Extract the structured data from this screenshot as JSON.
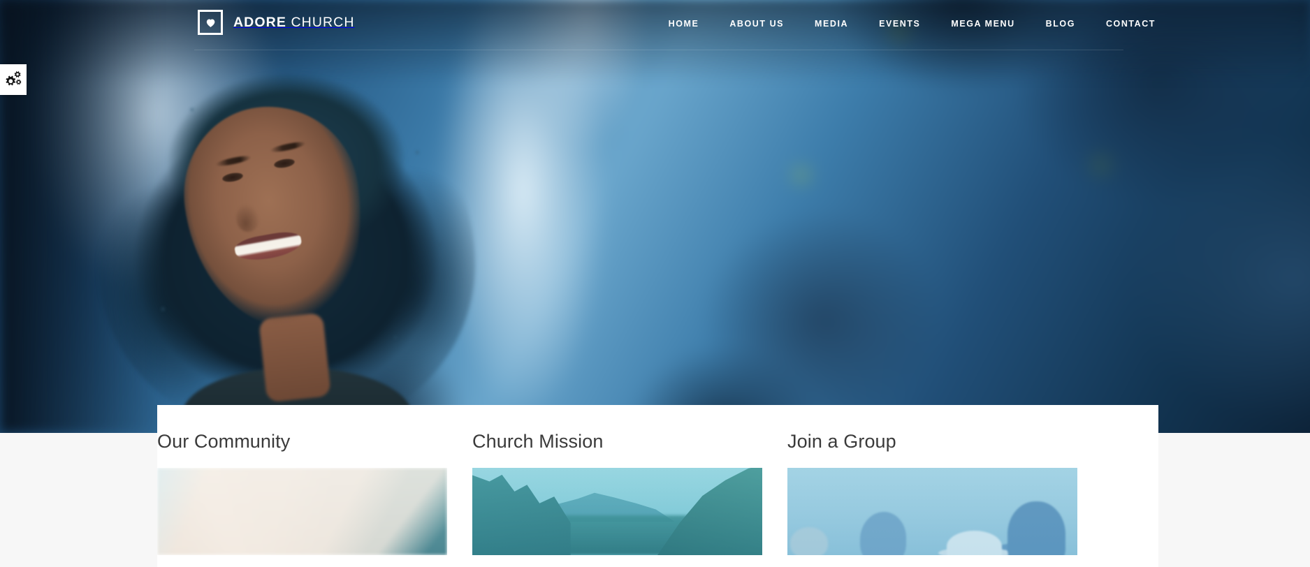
{
  "brand": {
    "mark_icon": "heart-icon",
    "name_bold": "ADORE",
    "name_light": "CHURCH"
  },
  "nav": {
    "items": [
      {
        "label": "HOME",
        "name": "nav-item-home"
      },
      {
        "label": "ABOUT US",
        "name": "nav-item-about-us"
      },
      {
        "label": "MEDIA",
        "name": "nav-item-media"
      },
      {
        "label": "EVENTS",
        "name": "nav-item-events"
      },
      {
        "label": "MEGA MENU",
        "name": "nav-item-mega-menu"
      },
      {
        "label": "BLOG",
        "name": "nav-item-blog"
      },
      {
        "label": "CONTACT",
        "name": "nav-item-contact"
      }
    ]
  },
  "widgets": {
    "settings_icon": "gears-icon"
  },
  "hero": {
    "image_alt": "Smiling woman with curly hair in front of a blurred blue waterfall cliff"
  },
  "cards": [
    {
      "title": "Our Community",
      "image_alt": "Group of people stacking hands together"
    },
    {
      "title": "Church Mission",
      "image_alt": "Forested mountain valley landscape"
    },
    {
      "title": "Join a Group",
      "image_alt": "People outdoors silhouetted against the sky"
    }
  ],
  "colors": {
    "panel_background": "#ffffff",
    "page_background": "#f7f7f7",
    "heading_text": "#3a3a3a",
    "nav_text": "#ffffff",
    "hero_blue": "#2d6f9e"
  }
}
